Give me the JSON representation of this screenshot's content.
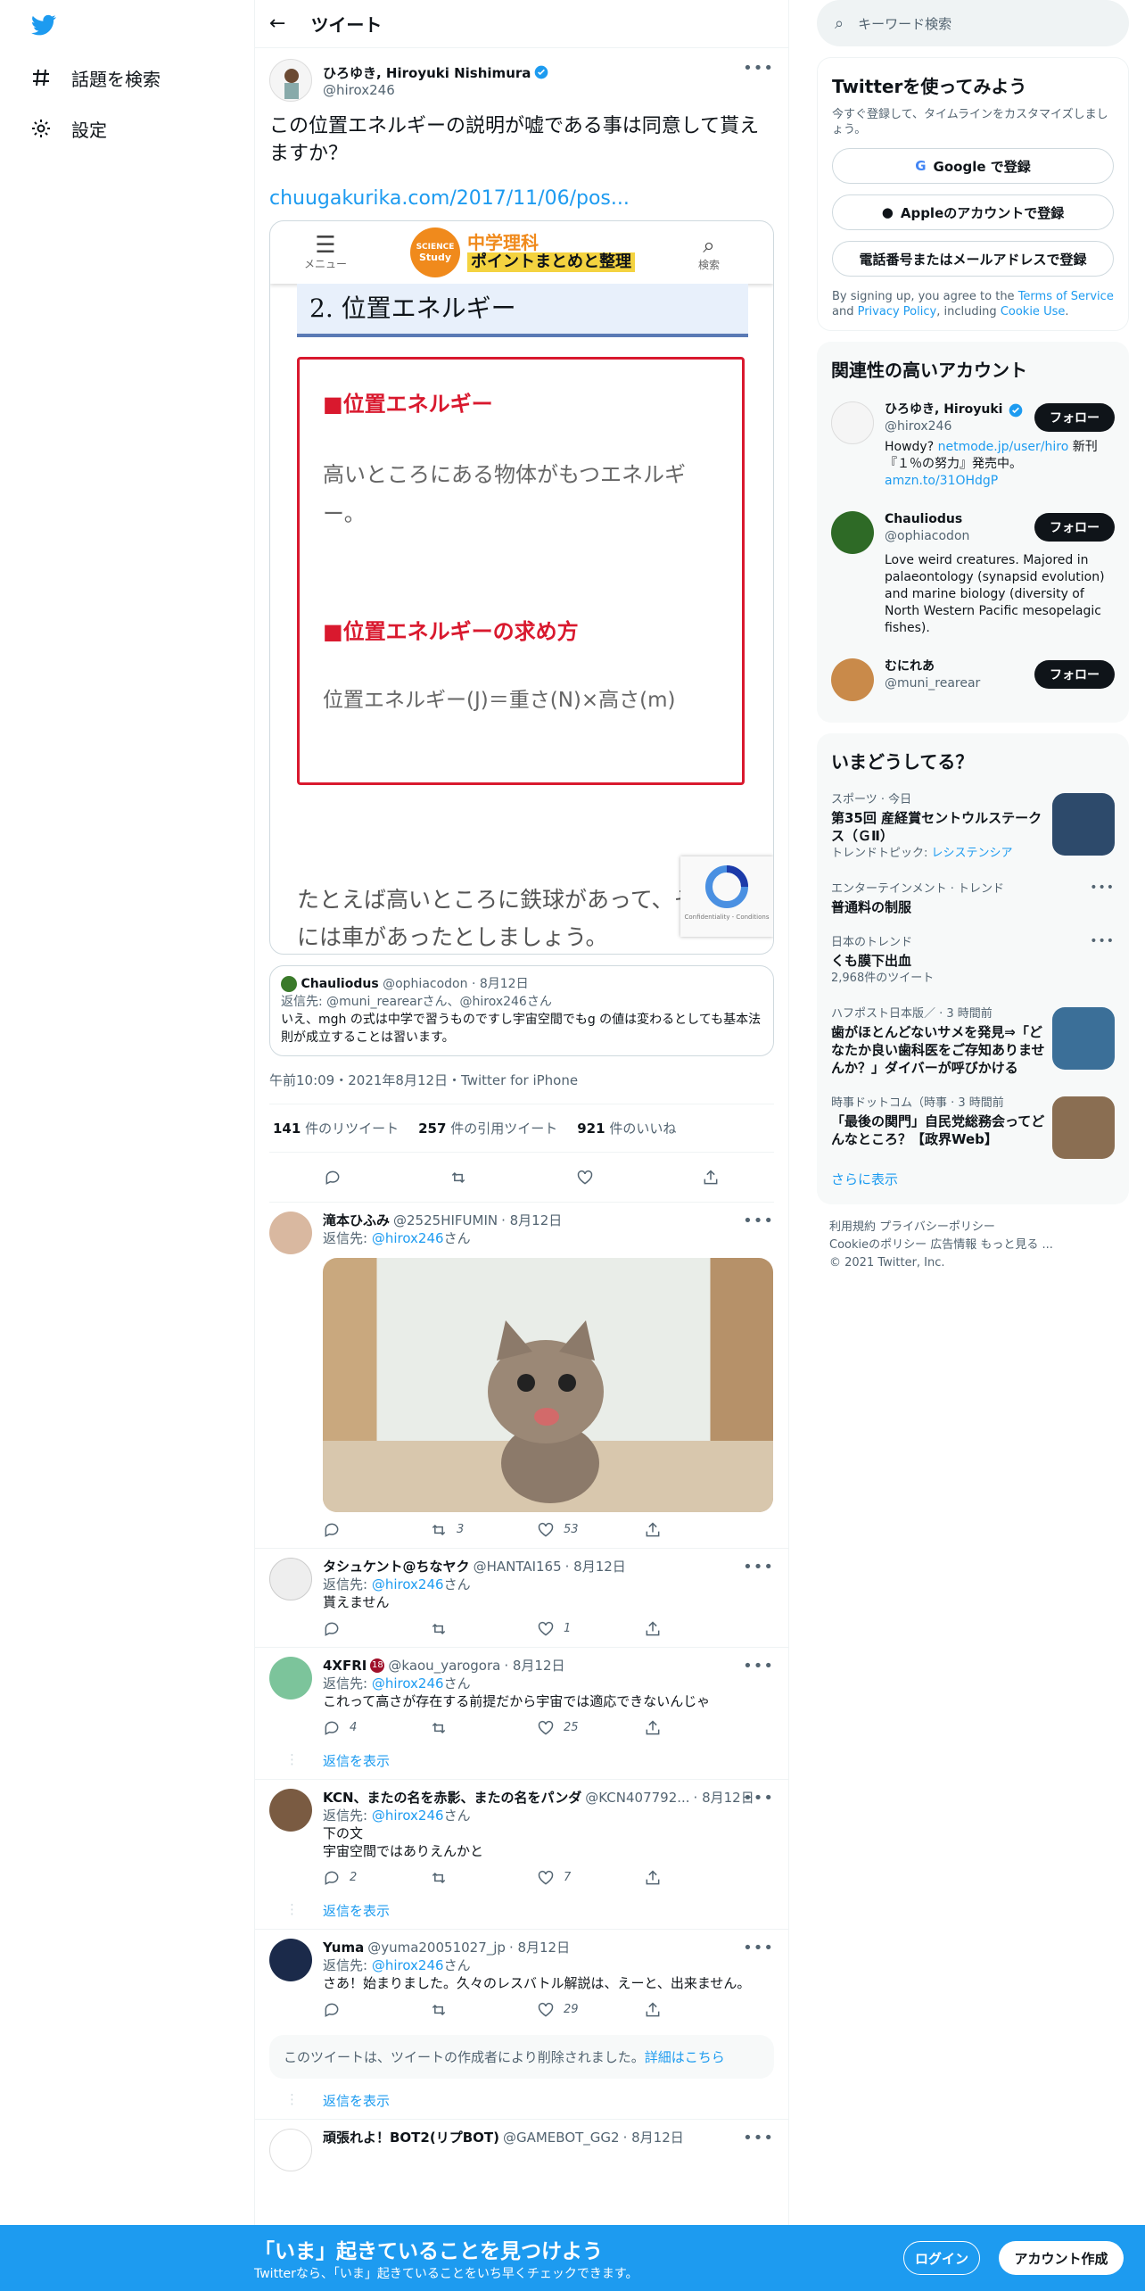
{
  "nav": {
    "search_label": "話題を検索",
    "settings_label": "設定"
  },
  "header": {
    "title": "ツイート"
  },
  "tweet": {
    "name": "ひろゆき, Hiroyuki Nishimura",
    "handle": "@hirox246",
    "text": "この位置エネルギーの説明が嘘である事は同意して貰えますか？",
    "link": "chuugakurika.com/2017/11/06/pos...",
    "card": {
      "menu_label": "メニュー",
      "search_label": "検索",
      "logo_line1": "中学理科",
      "logo_line2": "ポイントまとめと整理",
      "badge_top": "SCIENCE",
      "badge_bottom": "Study",
      "section": "2.  位置エネルギー",
      "h1": "■位置エネルギー",
      "desc": "高いところにある物体がもつエネルギー。",
      "h2": "■位置エネルギーの求め方",
      "formula": "位置エネルギー(J)＝重さ(N)×高さ(m)",
      "bottom": "たとえば高いところに鉄球があって、そ\nには車があったとしましょう。",
      "captcha": "Confidentiality - Conditions"
    },
    "quote": {
      "name": "Chauliodus",
      "handle": "@ophiacodon",
      "date": "· 8月12日",
      "reply_to": "返信先: @muni_rearearさん、@hirox246さん",
      "text": "いえ、mgh の式は中学で習うものですし宇宙空間でもg の値は変わるとしても基本法則が成立することは習います。"
    },
    "meta": "午前10:09・2021年8月12日・Twitter for iPhone",
    "stats": {
      "rt": "141",
      "rt_label": "件のリツイート",
      "qt": "257",
      "qt_label": "件の引用ツイート",
      "like": "921",
      "like_label": "件のいいね"
    }
  },
  "replies": [
    {
      "name": "滝本ひふみ",
      "handle": "@2525HIFUMIN",
      "date": "· 8月12日",
      "reply_to": "@hirox246",
      "reply_prefix": "返信先: ",
      "reply_suffix": "さん",
      "text": "",
      "rt": "3",
      "like": "53",
      "reply_count": ""
    },
    {
      "name": "タシュケント@ちなヤク",
      "handle": "@HANTAI165",
      "date": "· 8月12日",
      "reply_to": "@hirox246",
      "reply_prefix": "返信先: ",
      "reply_suffix": "さん",
      "text": "貰えません",
      "rt": "",
      "like": "1",
      "reply_count": ""
    },
    {
      "name": "4XFRI",
      "handle": "@kaou_yarogora",
      "date": "· 8月12日",
      "reply_to": "@hirox246",
      "reply_prefix": "返信先: ",
      "reply_suffix": "さん",
      "text": "これって高さが存在する前提だから宇宙では適応できないんじゃ",
      "rt": "",
      "like": "25",
      "reply_count": "4",
      "badge": "18"
    },
    {
      "name": "KCN、またの名を赤影、またの名をパンダ",
      "handle": "@KCN407792...",
      "date": "· 8月12日",
      "reply_to": "@hirox246",
      "reply_prefix": "返信先: ",
      "reply_suffix": "さん",
      "text": "下の文\n宇宙空間ではありえんかと",
      "rt": "",
      "like": "7",
      "reply_count": "2"
    },
    {
      "name": "Yuma",
      "handle": "@yuma20051027_jp",
      "date": "· 8月12日",
      "reply_to": "@hirox246",
      "reply_prefix": "返信先: ",
      "reply_suffix": "さん",
      "text": "さあ！始まりました。久々のレスバトル解説は、えーと、出来ません。",
      "rt": "",
      "like": "29",
      "reply_count": ""
    },
    {
      "name": "頑張れよ！BOT2(リプBOT)",
      "handle": "@GAMEBOT_GG2",
      "date": "· 8月12日",
      "reply_to": "",
      "reply_prefix": "",
      "reply_suffix": "",
      "text": "",
      "rt": "",
      "like": "",
      "reply_count": ""
    }
  ],
  "show_replies": "返信を表示",
  "deleted": {
    "text": "このツイートは、ツイートの作成者により削除されました。",
    "link": "詳細はこちら"
  },
  "right": {
    "search_placeholder": "キーワード検索",
    "signup": {
      "title": "Twitterを使ってみよう",
      "sub": "今すぐ登録して、タイムラインをカスタマイズしましょう。",
      "google": "Google で登録",
      "apple": "Appleのアカウントで登録",
      "phone": "電話番号またはメールアドレスで登録",
      "terms_pre": "By signing up, you agree to the ",
      "terms": "Terms of Service",
      "and": " and ",
      "privacy": "Privacy Policy",
      "including": ", including ",
      "cookie": "Cookie Use",
      "dot": "."
    },
    "related": {
      "title": "関連性の高いアカウント",
      "follow": "フォロー",
      "accounts": [
        {
          "name": "ひろゆき, Hiroyuki N",
          "handle": "@hirox246",
          "bio_pre": "Howdy? ",
          "bio_link": "netmode.jp/user/hiro",
          "bio_mid": " 新刊『１％の努力』発売中。 ",
          "bio_link2": "amzn.to/31OHdgP"
        },
        {
          "name": "Chauliodus",
          "handle": "@ophiacodon",
          "bio": "Love weird creatures. Majored in palaeontology (synapsid evolution) and marine biology (diversity of North Western Pacific mesopelagic fishes)."
        },
        {
          "name": "むにれあ",
          "handle": "@muni_rearear"
        }
      ]
    },
    "trends": {
      "title": "いまどうしてる？",
      "items": [
        {
          "cat": "スポーツ · 今日",
          "title": "第35回 産経賞セントウルステークス（ＧⅡ）",
          "extra_pre": "トレンドトピック: ",
          "extra_link": "レシステンシア"
        },
        {
          "cat": "エンターテインメント · トレンド",
          "title": "普通料の制服"
        },
        {
          "cat": "日本のトレンド",
          "title": "くも膜下出血",
          "extra": "2,968件のツイート"
        },
        {
          "cat": "ハフポスト日本版／ · 3 時間前",
          "title": "歯がほとんどないサメを発見⇒「どなたか良い歯科医をご存知ありませんか？」ダイバーが呼びかける"
        },
        {
          "cat": "時事ドットコム（時事 · 3 時間前",
          "title": "「最後の関門」自民党総務会ってどんなところ？【政界Web】"
        }
      ],
      "more": "さらに表示"
    },
    "footer": {
      "l1": "利用規約   プライバシーポリシー",
      "l2": "Cookieのポリシー   広告情報   もっと見る ...",
      "l3": "© 2021 Twitter, Inc."
    }
  },
  "bottom": {
    "title": "「いま」起きていることを見つけよう",
    "sub": "Twitterなら、「いま」起きていることをいち早くチェックできます。",
    "login": "ログイン",
    "signup": "アカウント作成"
  },
  "colors": {
    "accent": "#1d9bf0",
    "text": "#0f1419",
    "muted": "#536471",
    "red_box": "#d9192e"
  }
}
